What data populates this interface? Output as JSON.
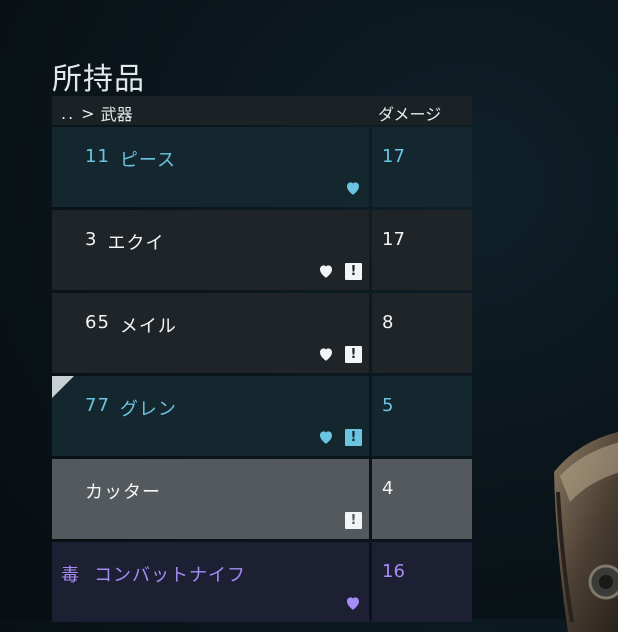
{
  "title": "所持品",
  "breadcrumb": {
    "up": "..",
    "separator": ">",
    "category": "武器"
  },
  "column_header": "ダメージ",
  "colors": {
    "cyan": "#6bc5e0",
    "purple": "#a68cf5",
    "white": "#f2f4f5"
  },
  "items": [
    {
      "quantity": "11",
      "name": "ピース",
      "damage": "17",
      "favorite": true,
      "warning": false,
      "style": "selected"
    },
    {
      "quantity": "3",
      "name": "エクイ",
      "damage": "17",
      "favorite": true,
      "warning": true,
      "style": "normal"
    },
    {
      "quantity": "65",
      "name": "メイル",
      "damage": "8",
      "favorite": true,
      "warning": true,
      "style": "normal"
    },
    {
      "quantity": "77",
      "name": "グレン",
      "damage": "5",
      "favorite": true,
      "warning": true,
      "style": "equipped"
    },
    {
      "quantity": "",
      "name": "カッター",
      "damage": "4",
      "favorite": false,
      "warning": true,
      "style": "highlight"
    },
    {
      "quantity": "",
      "prefix": "毒",
      "name": "コンバットナイフ",
      "damage": "16",
      "favorite": true,
      "warning": false,
      "style": "poison"
    }
  ]
}
